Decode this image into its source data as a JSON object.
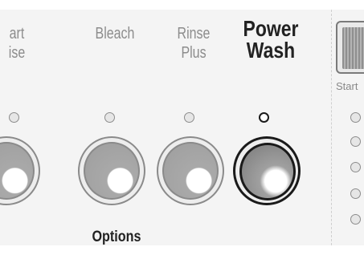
{
  "labels": {
    "partial": {
      "line1": "art",
      "line2": "ise"
    },
    "bleach": "Bleach",
    "rinse_plus": {
      "line1": "Rinse",
      "line2": "Plus"
    },
    "power_wash": {
      "line1": "Power",
      "line2": "Wash"
    }
  },
  "options_label": "Options",
  "start_label": "Start",
  "led_states": {
    "partial": "off",
    "bleach": "off",
    "rinse_plus": "off",
    "power_wash": "on"
  },
  "colors": {
    "panel": "#f4f4f4",
    "active": "#1a1a1a",
    "inactive": "#8c8c8c"
  }
}
